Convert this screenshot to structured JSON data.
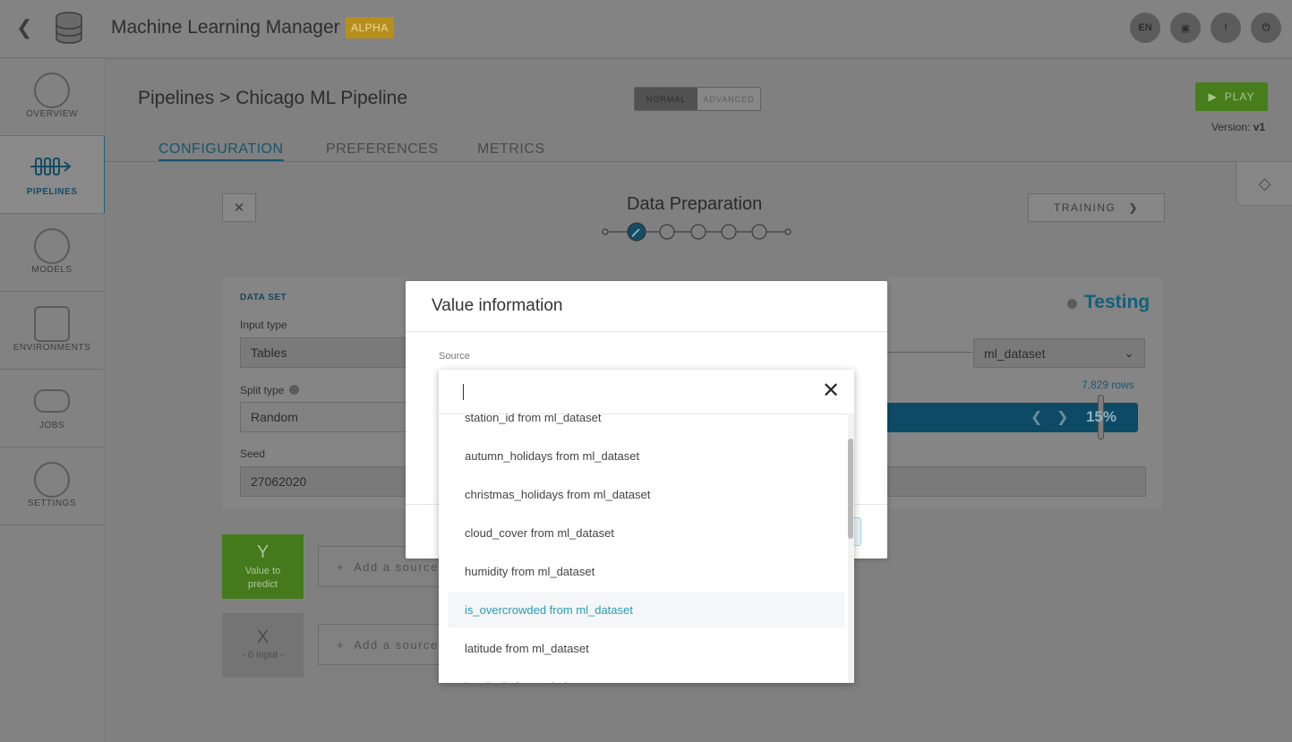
{
  "header": {
    "app_title": "Machine Learning Manager",
    "badge": "ALPHA",
    "buttons": [
      "EN",
      "",
      "",
      ""
    ]
  },
  "sidebar": {
    "items": [
      {
        "label": "OVERVIEW",
        "icon": "gauge-icon"
      },
      {
        "label": "PIPELINES",
        "icon": "pipeline-icon"
      },
      {
        "label": "MODELS",
        "icon": "atom-icon"
      },
      {
        "label": "ENVIRONMENTS",
        "icon": "cluster-icon"
      },
      {
        "label": "JOBS",
        "icon": "conveyor-icon"
      },
      {
        "label": "SETTINGS",
        "icon": "gear-icon"
      }
    ]
  },
  "page": {
    "breadcrumb_root": "Pipelines",
    "breadcrumb_sep": ">",
    "breadcrumb_current": "Chicago ML Pipeline",
    "mode_normal": "NORMAL",
    "mode_advanced": "ADVANCED",
    "play_label": "PLAY",
    "version_label": "Version:",
    "version_value": "v1",
    "tabs": [
      "CONFIGURATION",
      "PREFERENCES",
      "METRICS"
    ],
    "step_title": "Data Preparation",
    "next_step_label": "TRAINING"
  },
  "dataset": {
    "section_title": "DATA SET",
    "input_type_label": "Input type",
    "input_type_value": "Tables",
    "split_type_label": "Split type",
    "split_type_value": "Random",
    "seed_label": "Seed",
    "seed_value": "27062020",
    "testing_label": "Testing",
    "dataset_select": "ml_dataset",
    "rows": "7,829 rows",
    "split_percent": "15%",
    "split_fraction": 0.15
  },
  "vars": {
    "y_letter": "Y",
    "y_caption": "Value to predict",
    "x_letter": "X",
    "x_caption": "- 0 input -",
    "add_source": "Add a source"
  },
  "modal": {
    "title": "Value information",
    "source_label": "Source",
    "search_value": "",
    "options": [
      "station_id from ml_dataset",
      "autumn_holidays from ml_dataset",
      "christmas_holidays from ml_dataset",
      "cloud_cover from ml_dataset",
      "humidity from ml_dataset",
      "is_overcrowded from ml_dataset",
      "latitude from ml_dataset",
      "longitude from ml_dataset"
    ],
    "highlighted_index": 5
  }
}
